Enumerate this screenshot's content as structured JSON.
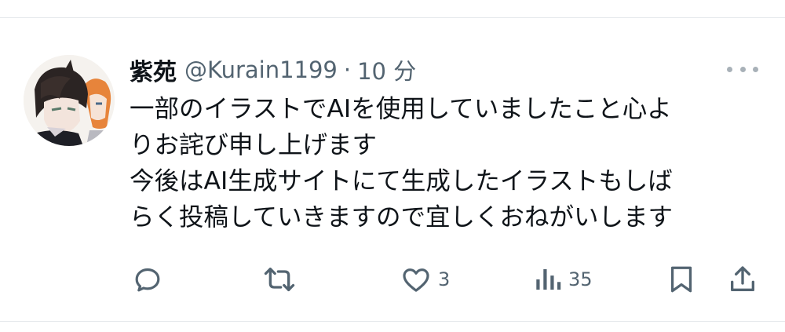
{
  "tweet": {
    "display_name": "紫苑",
    "handle": "@Kurain1199",
    "separator": "·",
    "time": "10 分",
    "lines": [
      "一部のイラストでAIを使用していましたこと心よ",
      "りお詫び申し上げます",
      "今後はAI生成サイトにて生成したイラストもしば",
      "らく投稿していきますので宜しくおねがいします"
    ]
  },
  "actions": {
    "reply": {
      "icon": "reply-icon",
      "count": ""
    },
    "retweet": {
      "icon": "retweet-icon",
      "count": ""
    },
    "like": {
      "icon": "heart-icon",
      "count": "3"
    },
    "views": {
      "icon": "views-icon",
      "count": "35"
    },
    "bookmark": {
      "icon": "bookmark-icon",
      "count": ""
    },
    "share": {
      "icon": "share-icon",
      "count": ""
    }
  },
  "colors": {
    "text": "#0f1419",
    "secondary": "#536471",
    "icon": "#536471",
    "divider": "#e6e9ec"
  }
}
